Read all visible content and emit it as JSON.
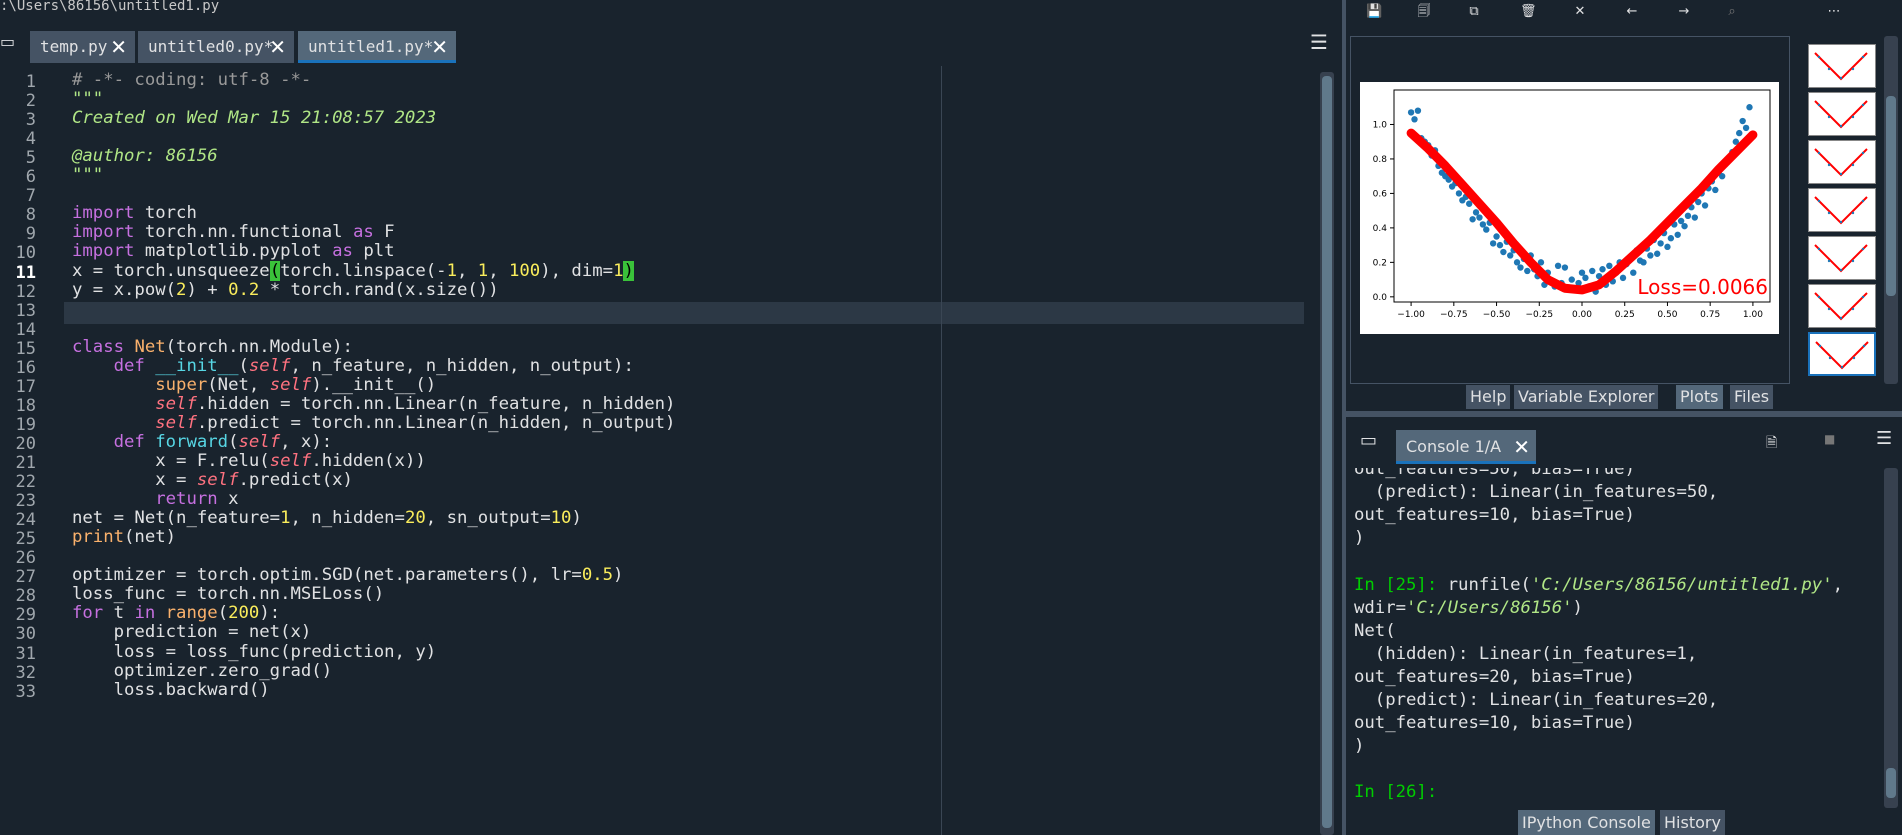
{
  "editor": {
    "path": ":\\Users\\86156\\untitled1.py",
    "tabs": [
      {
        "label": "temp.py",
        "active": false
      },
      {
        "label": "untitled0.py*",
        "active": false
      },
      {
        "label": "untitled1.py*",
        "active": true
      }
    ],
    "current_line": 11,
    "lines": [
      "# -*- coding: utf-8 -*-",
      "\"\"\"",
      "Created on Wed Mar 15 21:08:57 2023",
      "",
      "@author: 86156",
      "\"\"\"",
      "",
      "import torch",
      "import torch.nn.functional as F",
      "import matplotlib.pyplot as plt",
      "x = torch.unsqueeze(torch.linspace(-1, 1, 100), dim=1)",
      "y = x.pow(2) + 0.2 * torch.rand(x.size())",
      "",
      "",
      "class Net(torch.nn.Module):",
      "    def __init__(self, n_feature, n_hidden, n_output):",
      "        super(Net, self).__init__()",
      "        self.hidden = torch.nn.Linear(n_feature, n_hidden)",
      "        self.predict = torch.nn.Linear(n_hidden, n_output)",
      "    def forward(self, x):",
      "        x = F.relu(self.hidden(x))",
      "        x = self.predict(x)",
      "        return x",
      "net = Net(n_feature=1, n_hidden=20, sn_output=10)",
      "print(net)",
      "",
      "optimizer = torch.optim.SGD(net.parameters(), lr=0.5)",
      "loss_func = torch.nn.MSELoss()",
      "for t in range(200):",
      "    prediction = net(x)",
      "    loss = loss_func(prediction, y)",
      "    optimizer.zero_grad()",
      "    loss.backward()"
    ]
  },
  "plots": {
    "tabs": [
      {
        "label": "Help",
        "active": false
      },
      {
        "label": "Variable Explorer",
        "active": false
      },
      {
        "label": "Plots",
        "active": true
      },
      {
        "label": "Files",
        "active": false
      }
    ],
    "toolbar_icons": [
      "save-icon",
      "save-all-icon",
      "copy-icon",
      "trash-icon",
      "close-all-icon",
      "arrow-left-icon",
      "arrow-right-icon",
      "zoom-icon",
      "menu-icon"
    ],
    "thumbnail_count": 7,
    "loss_label": "Loss=0.0066"
  },
  "chart_data": {
    "type": "scatter",
    "title": "",
    "xlabel": "",
    "ylabel": "",
    "xlim": [
      -1.1,
      1.1
    ],
    "ylim": [
      -0.03,
      1.2
    ],
    "xticks": [
      "−1.00",
      "−0.75",
      "−0.50",
      "−0.25",
      "0.00",
      "0.25",
      "0.50",
      "0.75",
      "1.00"
    ],
    "yticks": [
      "0.0",
      "0.2",
      "0.4",
      "0.6",
      "0.8",
      "1.0"
    ],
    "annotation": "Loss=0.0066",
    "series": [
      {
        "kind": "scatter",
        "color": "#1f77b4",
        "points": [
          [
            -1.0,
            1.07
          ],
          [
            -0.98,
            1.03
          ],
          [
            -0.96,
            1.08
          ],
          [
            -0.94,
            0.92
          ],
          [
            -0.92,
            0.9
          ],
          [
            -0.9,
            0.88
          ],
          [
            -0.88,
            0.82
          ],
          [
            -0.86,
            0.85
          ],
          [
            -0.84,
            0.76
          ],
          [
            -0.82,
            0.72
          ],
          [
            -0.8,
            0.7
          ],
          [
            -0.78,
            0.68
          ],
          [
            -0.76,
            0.64
          ],
          [
            -0.74,
            0.66
          ],
          [
            -0.72,
            0.6
          ],
          [
            -0.7,
            0.56
          ],
          [
            -0.68,
            0.58
          ],
          [
            -0.66,
            0.54
          ],
          [
            -0.64,
            0.45
          ],
          [
            -0.62,
            0.49
          ],
          [
            -0.6,
            0.46
          ],
          [
            -0.58,
            0.42
          ],
          [
            -0.56,
            0.39
          ],
          [
            -0.54,
            0.43
          ],
          [
            -0.52,
            0.31
          ],
          [
            -0.5,
            0.35
          ],
          [
            -0.48,
            0.3
          ],
          [
            -0.46,
            0.26
          ],
          [
            -0.44,
            0.32
          ],
          [
            -0.42,
            0.24
          ],
          [
            -0.4,
            0.27
          ],
          [
            -0.38,
            0.2
          ],
          [
            -0.36,
            0.17
          ],
          [
            -0.34,
            0.22
          ],
          [
            -0.32,
            0.15
          ],
          [
            -0.3,
            0.24
          ],
          [
            -0.28,
            0.16
          ],
          [
            -0.26,
            0.12
          ],
          [
            -0.24,
            0.2
          ],
          [
            -0.22,
            0.07
          ],
          [
            -0.2,
            0.14
          ],
          [
            -0.18,
            0.09
          ],
          [
            -0.16,
            0.06
          ],
          [
            -0.14,
            0.18
          ],
          [
            -0.12,
            0.08
          ],
          [
            -0.1,
            0.17
          ],
          [
            -0.08,
            0.05
          ],
          [
            -0.06,
            0.1
          ],
          [
            -0.04,
            0.04
          ],
          [
            -0.02,
            0.08
          ],
          [
            0.0,
            0.14
          ],
          [
            0.02,
            0.11
          ],
          [
            0.04,
            0.06
          ],
          [
            0.06,
            0.15
          ],
          [
            0.08,
            0.03
          ],
          [
            0.1,
            0.12
          ],
          [
            0.12,
            0.16
          ],
          [
            0.14,
            0.07
          ],
          [
            0.16,
            0.18
          ],
          [
            0.18,
            0.09
          ],
          [
            0.2,
            0.14
          ],
          [
            0.22,
            0.2
          ],
          [
            0.24,
            0.11
          ],
          [
            0.26,
            0.19
          ],
          [
            0.28,
            0.23
          ],
          [
            0.3,
            0.14
          ],
          [
            0.32,
            0.27
          ],
          [
            0.34,
            0.21
          ],
          [
            0.36,
            0.2
          ],
          [
            0.38,
            0.28
          ],
          [
            0.4,
            0.24
          ],
          [
            0.42,
            0.33
          ],
          [
            0.44,
            0.25
          ],
          [
            0.46,
            0.31
          ],
          [
            0.48,
            0.37
          ],
          [
            0.5,
            0.29
          ],
          [
            0.52,
            0.34
          ],
          [
            0.54,
            0.42
          ],
          [
            0.56,
            0.36
          ],
          [
            0.58,
            0.44
          ],
          [
            0.6,
            0.41
          ],
          [
            0.62,
            0.47
          ],
          [
            0.64,
            0.52
          ],
          [
            0.66,
            0.46
          ],
          [
            0.68,
            0.55
          ],
          [
            0.7,
            0.6
          ],
          [
            0.72,
            0.53
          ],
          [
            0.74,
            0.63
          ],
          [
            0.76,
            0.67
          ],
          [
            0.78,
            0.62
          ],
          [
            0.8,
            0.72
          ],
          [
            0.82,
            0.7
          ],
          [
            0.84,
            0.78
          ],
          [
            0.86,
            0.8
          ],
          [
            0.88,
            0.84
          ],
          [
            0.9,
            0.9
          ],
          [
            0.92,
            0.95
          ],
          [
            0.94,
            1.02
          ],
          [
            0.96,
            0.98
          ],
          [
            0.98,
            1.1
          ]
        ]
      },
      {
        "kind": "line",
        "color": "#ff0000",
        "points": [
          [
            -1.0,
            0.95
          ],
          [
            -0.9,
            0.86
          ],
          [
            -0.8,
            0.76
          ],
          [
            -0.7,
            0.65
          ],
          [
            -0.6,
            0.54
          ],
          [
            -0.5,
            0.43
          ],
          [
            -0.4,
            0.31
          ],
          [
            -0.3,
            0.2
          ],
          [
            -0.2,
            0.1
          ],
          [
            -0.1,
            0.05
          ],
          [
            0.0,
            0.04
          ],
          [
            0.1,
            0.07
          ],
          [
            0.2,
            0.15
          ],
          [
            0.3,
            0.24
          ],
          [
            0.4,
            0.33
          ],
          [
            0.5,
            0.43
          ],
          [
            0.6,
            0.53
          ],
          [
            0.7,
            0.63
          ],
          [
            0.8,
            0.74
          ],
          [
            0.9,
            0.84
          ],
          [
            1.0,
            0.94
          ]
        ]
      }
    ]
  },
  "console": {
    "tab_label": "Console 1/A",
    "lines": [
      {
        "text": "out_features=50, bias=True)",
        "type": "out"
      },
      {
        "text": "  (predict): Linear(in_features=50,",
        "type": "out"
      },
      {
        "text": "out_features=10, bias=True)",
        "type": "out"
      },
      {
        "text": ")",
        "type": "out"
      },
      {
        "text": "",
        "type": "out"
      },
      {
        "prompt": "In [25]: ",
        "text": "runfile(",
        "str1": "'C:/Users/86156/untitled1.py'",
        "tail": ",",
        "type": "in"
      },
      {
        "text": "wdir=",
        "str1": "'C:/Users/86156'",
        "tail": ")",
        "type": "in2"
      },
      {
        "text": "Net(",
        "type": "out"
      },
      {
        "text": "  (hidden): Linear(in_features=1,",
        "type": "out"
      },
      {
        "text": "out_features=20, bias=True)",
        "type": "out"
      },
      {
        "text": "  (predict): Linear(in_features=20,",
        "type": "out"
      },
      {
        "text": "out_features=10, bias=True)",
        "type": "out"
      },
      {
        "text": ")",
        "type": "out"
      },
      {
        "text": "",
        "type": "out"
      },
      {
        "prompt": "In [26]:",
        "text": "",
        "type": "prompt"
      }
    ],
    "tabs": [
      {
        "label": "IPython Console",
        "active": true
      },
      {
        "label": "History",
        "active": false
      }
    ]
  }
}
